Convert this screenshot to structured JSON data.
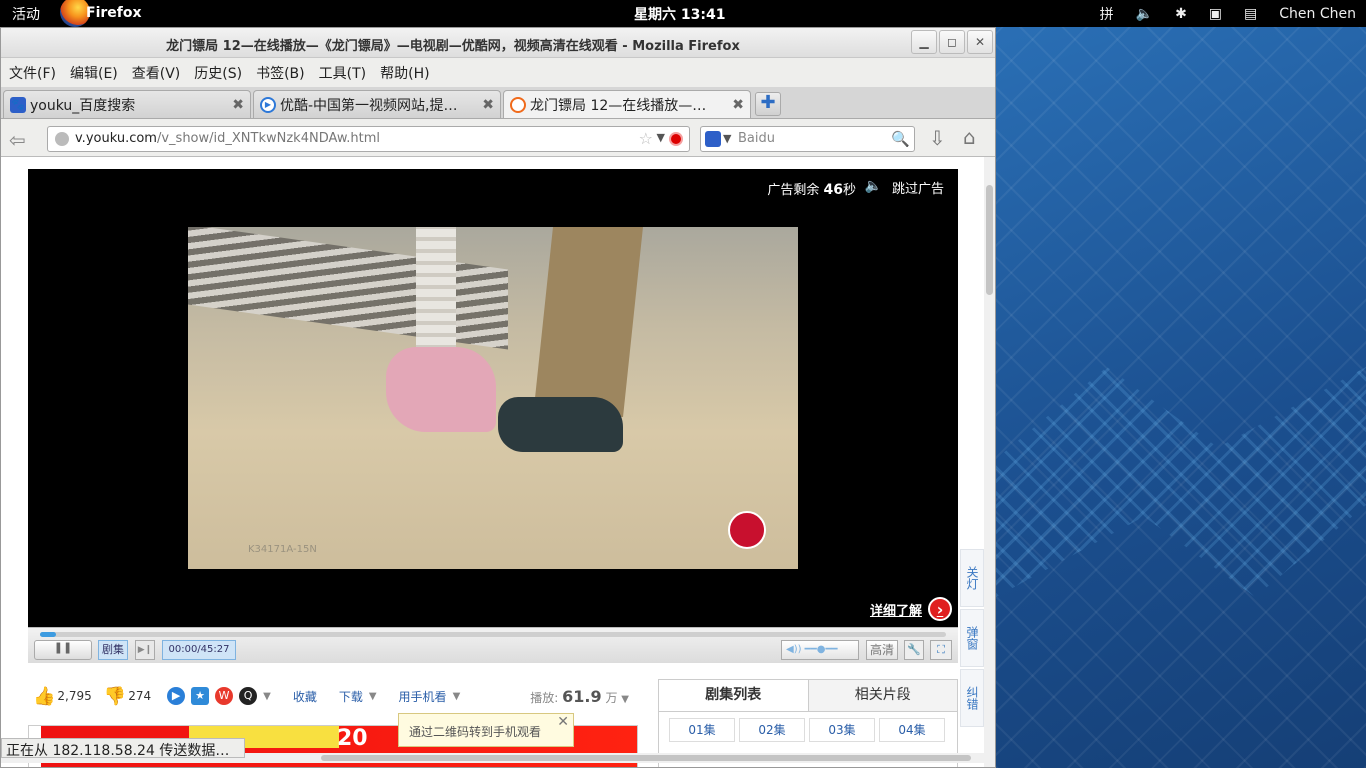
{
  "topbar": {
    "activities": "活动",
    "app_name": "Firefox",
    "clock": "星期六 13:41",
    "input_method": "拼",
    "user": "Chen Chen"
  },
  "window": {
    "title": "龙门镖局 12—在线播放—《龙门镖局》—电视剧—优酷网，视频高清在线观看  -  Mozilla Firefox"
  },
  "menu": [
    "文件(F)",
    "编辑(E)",
    "查看(V)",
    "历史(S)",
    "书签(B)",
    "工具(T)",
    "帮助(H)"
  ],
  "tabs": [
    {
      "label": "youku_百度搜索",
      "active": false
    },
    {
      "label": "优酷-中国第一视频网站,提…",
      "active": false
    },
    {
      "label": "龙门镖局 12—在线播放—…",
      "active": true
    }
  ],
  "navbar": {
    "url_domain": "v.youku.com",
    "url_path": "/v_show/id_XNTkwNzk4NDAw.html",
    "search_placeholder": "Baidu"
  },
  "player": {
    "ad_prefix": "广告剩余",
    "ad_seconds": "46",
    "ad_suffix": "秒",
    "skip_ad": "跳过广告",
    "frame_code": "K34171A-15N",
    "learn_more": "详细了解",
    "progress": 0.018,
    "episodes_button": "剧集",
    "time": "00:00/45:27",
    "hd_button": "高清"
  },
  "side_buttons": [
    "关灯",
    "弹窗",
    "纠错"
  ],
  "actions": {
    "likes": "2,795",
    "dislikes": "274",
    "favorite": "收藏",
    "download": "下载",
    "mobile": "用手机看",
    "plays_label": "播放:",
    "plays_value": "61.9",
    "plays_unit": "万"
  },
  "tooltip": "通过二维码转到手机观看",
  "episode_panel": {
    "tabs": [
      "剧集列表",
      "相关片段"
    ],
    "episodes": [
      "01集",
      "02集",
      "03集",
      "04集"
    ]
  },
  "status": "正在从 182.118.58.24 传送数据…",
  "colors": {
    "accent": "#2a5ea8",
    "ad_red": "#e02020"
  }
}
